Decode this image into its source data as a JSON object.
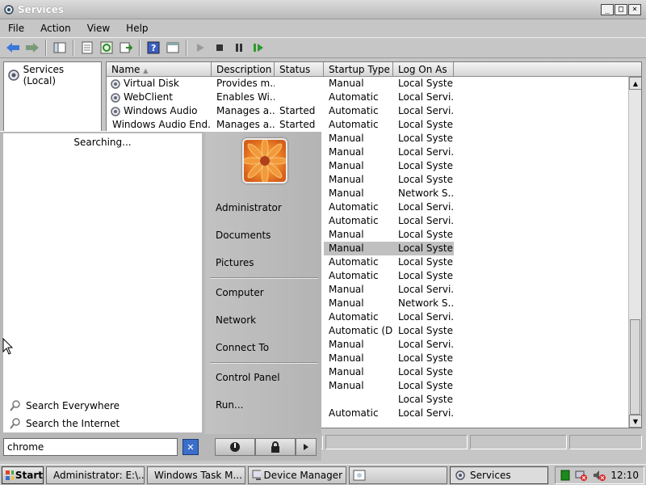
{
  "window": {
    "title": "Services",
    "controls": {
      "minimize": "_",
      "maximize": "□",
      "close": "×"
    }
  },
  "menu": [
    "File",
    "Action",
    "View",
    "Help"
  ],
  "tree": {
    "root": "Services (Local)"
  },
  "columns": {
    "name": "Name",
    "description": "Description",
    "status": "Status",
    "startup": "Startup Type",
    "logon": "Log On As"
  },
  "rows": [
    {
      "name": "Virtual Disk",
      "description": "Provides m...",
      "status": "",
      "startup": "Manual",
      "logon": "Local System"
    },
    {
      "name": "WebClient",
      "description": "Enables Wi...",
      "status": "",
      "startup": "Automatic",
      "logon": "Local Servi..."
    },
    {
      "name": "Windows Audio",
      "description": "Manages a...",
      "status": "Started",
      "startup": "Automatic",
      "logon": "Local Servi..."
    },
    {
      "name": "Windows Audio End...",
      "description": "Manages a...",
      "status": "Started",
      "startup": "Automatic",
      "logon": "Local System"
    },
    {
      "name": "",
      "description": "",
      "status": "",
      "startup": "Manual",
      "logon": "Local System"
    },
    {
      "name": "",
      "description": "",
      "status": "",
      "startup": "Manual",
      "logon": "Local Servi..."
    },
    {
      "name": "",
      "description": "",
      "status": "",
      "startup": "Manual",
      "logon": "Local System"
    },
    {
      "name": "",
      "description": "",
      "status": "",
      "startup": "Manual",
      "logon": "Local System"
    },
    {
      "name": "",
      "description": "",
      "status": "",
      "startup": "Manual",
      "logon": "Network S..."
    },
    {
      "name": "",
      "description": "",
      "status": "",
      "startup": "Automatic",
      "logon": "Local Servi..."
    },
    {
      "name": "",
      "description": "",
      "status": "",
      "startup": "Automatic",
      "logon": "Local Servi..."
    },
    {
      "name": "",
      "description": "",
      "status": "",
      "startup": "Manual",
      "logon": "Local System"
    },
    {
      "name": "",
      "description": "",
      "status": "",
      "startup": "Manual",
      "logon": "Local System",
      "selected": true
    },
    {
      "name": "",
      "description": "",
      "status": "",
      "startup": "Automatic",
      "logon": "Local System"
    },
    {
      "name": "",
      "description": "",
      "status": "",
      "startup": "Automatic",
      "logon": "Local System"
    },
    {
      "name": "",
      "description": "",
      "status": "",
      "startup": "Manual",
      "logon": "Local Servi..."
    },
    {
      "name": "",
      "description": "",
      "status": "",
      "startup": "Manual",
      "logon": "Network S..."
    },
    {
      "name": "",
      "description": "",
      "status": "",
      "startup": "Automatic",
      "logon": "Local Servi..."
    },
    {
      "name": "",
      "description": "",
      "status": "",
      "startup": "Automatic (D...",
      "logon": "Local System"
    },
    {
      "name": "",
      "description": "",
      "status": "",
      "startup": "Manual",
      "logon": "Local Servi..."
    },
    {
      "name": "",
      "description": "",
      "status": "",
      "startup": "Manual",
      "logon": "Local System"
    },
    {
      "name": "",
      "description": "",
      "status": "",
      "startup": "Manual",
      "logon": "Local System"
    },
    {
      "name": "",
      "description": "",
      "status": "",
      "startup": "Manual",
      "logon": "Local System"
    },
    {
      "name": "",
      "description": "",
      "status": "",
      "startup": "",
      "logon": "Local System"
    },
    {
      "name": "",
      "description": "",
      "status": "",
      "startup": "Automatic",
      "logon": "Local Servi..."
    }
  ],
  "startmenu": {
    "searching": "Searching...",
    "search_everywhere": "Search Everywhere",
    "search_internet": "Search the Internet",
    "search_value": "chrome",
    "clear_label": "✕",
    "right_items": {
      "administrator": "Administrator",
      "documents": "Documents",
      "pictures": "Pictures",
      "computer": "Computer",
      "network": "Network",
      "connect_to": "Connect To",
      "control_panel": "Control Panel",
      "run": "Run..."
    }
  },
  "taskbar": {
    "start": "Start",
    "buttons": [
      "Administrator: E:\\...",
      "Windows Task M...",
      "Device Manager",
      "",
      "Services"
    ],
    "clock": "12:10"
  },
  "colors": {
    "selection": "#c0c0c0",
    "accent": "#3a6ec8"
  }
}
